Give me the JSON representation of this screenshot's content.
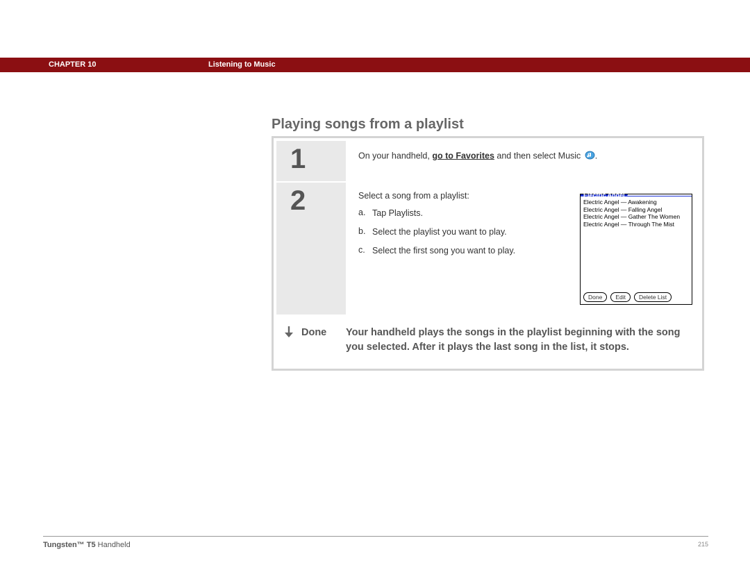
{
  "header": {
    "chapter_label": "CHAPTER 10",
    "section_title": "Listening to Music"
  },
  "page_title": "Playing songs from a playlist",
  "steps": {
    "one": {
      "num": "1",
      "prefix": "On your handheld, ",
      "link_text": "go to Favorites",
      "suffix": " and then select Music ",
      "period": "."
    },
    "two": {
      "num": "2",
      "intro": "Select a song from a playlist:",
      "a_letter": "a.",
      "a_text": "Tap Playlists.",
      "b_letter": "b.",
      "b_text": "Select the playlist you want to play.",
      "c_letter": "c.",
      "c_text": "Select the first song you want to play."
    }
  },
  "palm": {
    "title": "Electric Angel",
    "items": [
      "Electric Angel — Awakening",
      "Electric Angel — Falling Angel",
      "Electric Angel — Gather The Women",
      "Electric Angel — Through The Mist"
    ],
    "btn_done": "Done",
    "btn_edit": "Edit",
    "btn_delete": "Delete List"
  },
  "done": {
    "label": "Done",
    "text": "Your handheld plays the songs in the playlist beginning with the song you selected. After it plays the last song in the list, it stops."
  },
  "footer": {
    "product": "Tungsten™ T5",
    "suffix": " Handheld",
    "page_number": "215"
  }
}
